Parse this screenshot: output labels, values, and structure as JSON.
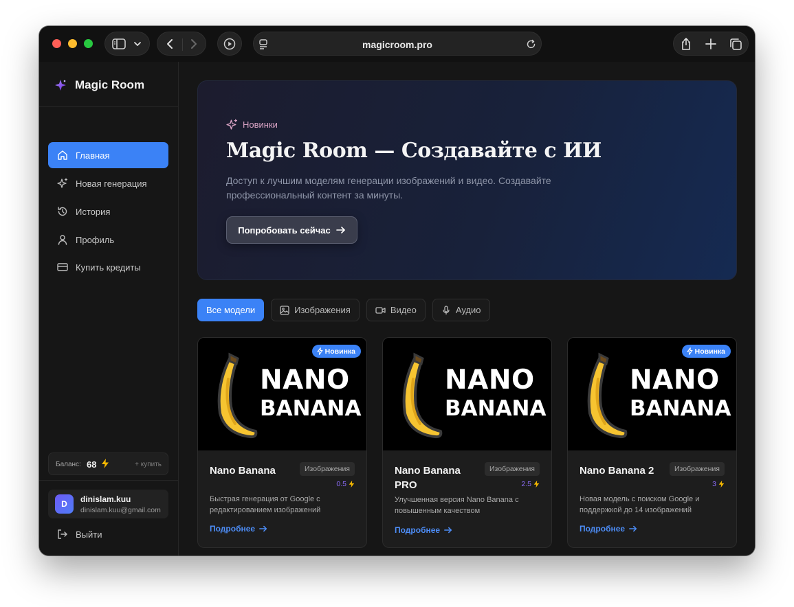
{
  "browser": {
    "url": "magicroom.pro"
  },
  "sidebar": {
    "brand": "Magic Room",
    "nav": [
      {
        "label": "Главная",
        "icon": "home-icon",
        "active": true
      },
      {
        "label": "Новая генерация",
        "icon": "sparkles-icon",
        "active": false
      },
      {
        "label": "История",
        "icon": "history-icon",
        "active": false
      },
      {
        "label": "Профиль",
        "icon": "user-icon",
        "active": false
      },
      {
        "label": "Купить кредиты",
        "icon": "credit-card-icon",
        "active": false
      }
    ],
    "balance": {
      "label": "Баланс:",
      "value": "68",
      "buy": "+ купить"
    },
    "user": {
      "initial": "D",
      "name": "dinislam.kuu",
      "email": "dinislam.kuu@gmail.com"
    },
    "logout": "Выйти"
  },
  "hero": {
    "badge": "Новинки",
    "title": "Magic Room — Создавайте с ИИ",
    "description": "Доступ к лучшим моделям генерации изображений и видео. Создавайте профессиональный контент за минуты.",
    "cta": "Попробовать сейчас"
  },
  "filters": [
    {
      "label": "Все модели",
      "active": true,
      "icon": ""
    },
    {
      "label": "Изображения",
      "active": false,
      "icon": "image-icon"
    },
    {
      "label": "Видео",
      "active": false,
      "icon": "video-icon"
    },
    {
      "label": "Аудио",
      "active": false,
      "icon": "mic-icon"
    }
  ],
  "cards": [
    {
      "image_text_line1": "NANO",
      "image_text_line2": "BANANA",
      "badge": "Новинка",
      "title": "Nano Banana",
      "category": "Изображения",
      "price": "0.5",
      "description": "Быстрая генерация от Google с редактированием изображений",
      "more": "Подробнее"
    },
    {
      "image_text_line1": "NANO",
      "image_text_line2": "BANANA",
      "badge": "",
      "title": "Nano Banana PRO",
      "category": "Изображения",
      "price": "2.5",
      "description": "Улучшенная версия Nano Banana с повышенным качеством",
      "more": "Подробнее"
    },
    {
      "image_text_line1": "NANO",
      "image_text_line2": "BANANA",
      "badge": "Новинка",
      "title": "Nano Banana 2",
      "category": "Изображения",
      "price": "3",
      "description": "Новая модель с поиском Google и поддержкой до 14 изображений",
      "more": "Подробнее"
    }
  ],
  "colors": {
    "accent": "#3b82f6",
    "price": "#8b6cf6",
    "bolt": "#f5b800",
    "background": "#161616"
  }
}
